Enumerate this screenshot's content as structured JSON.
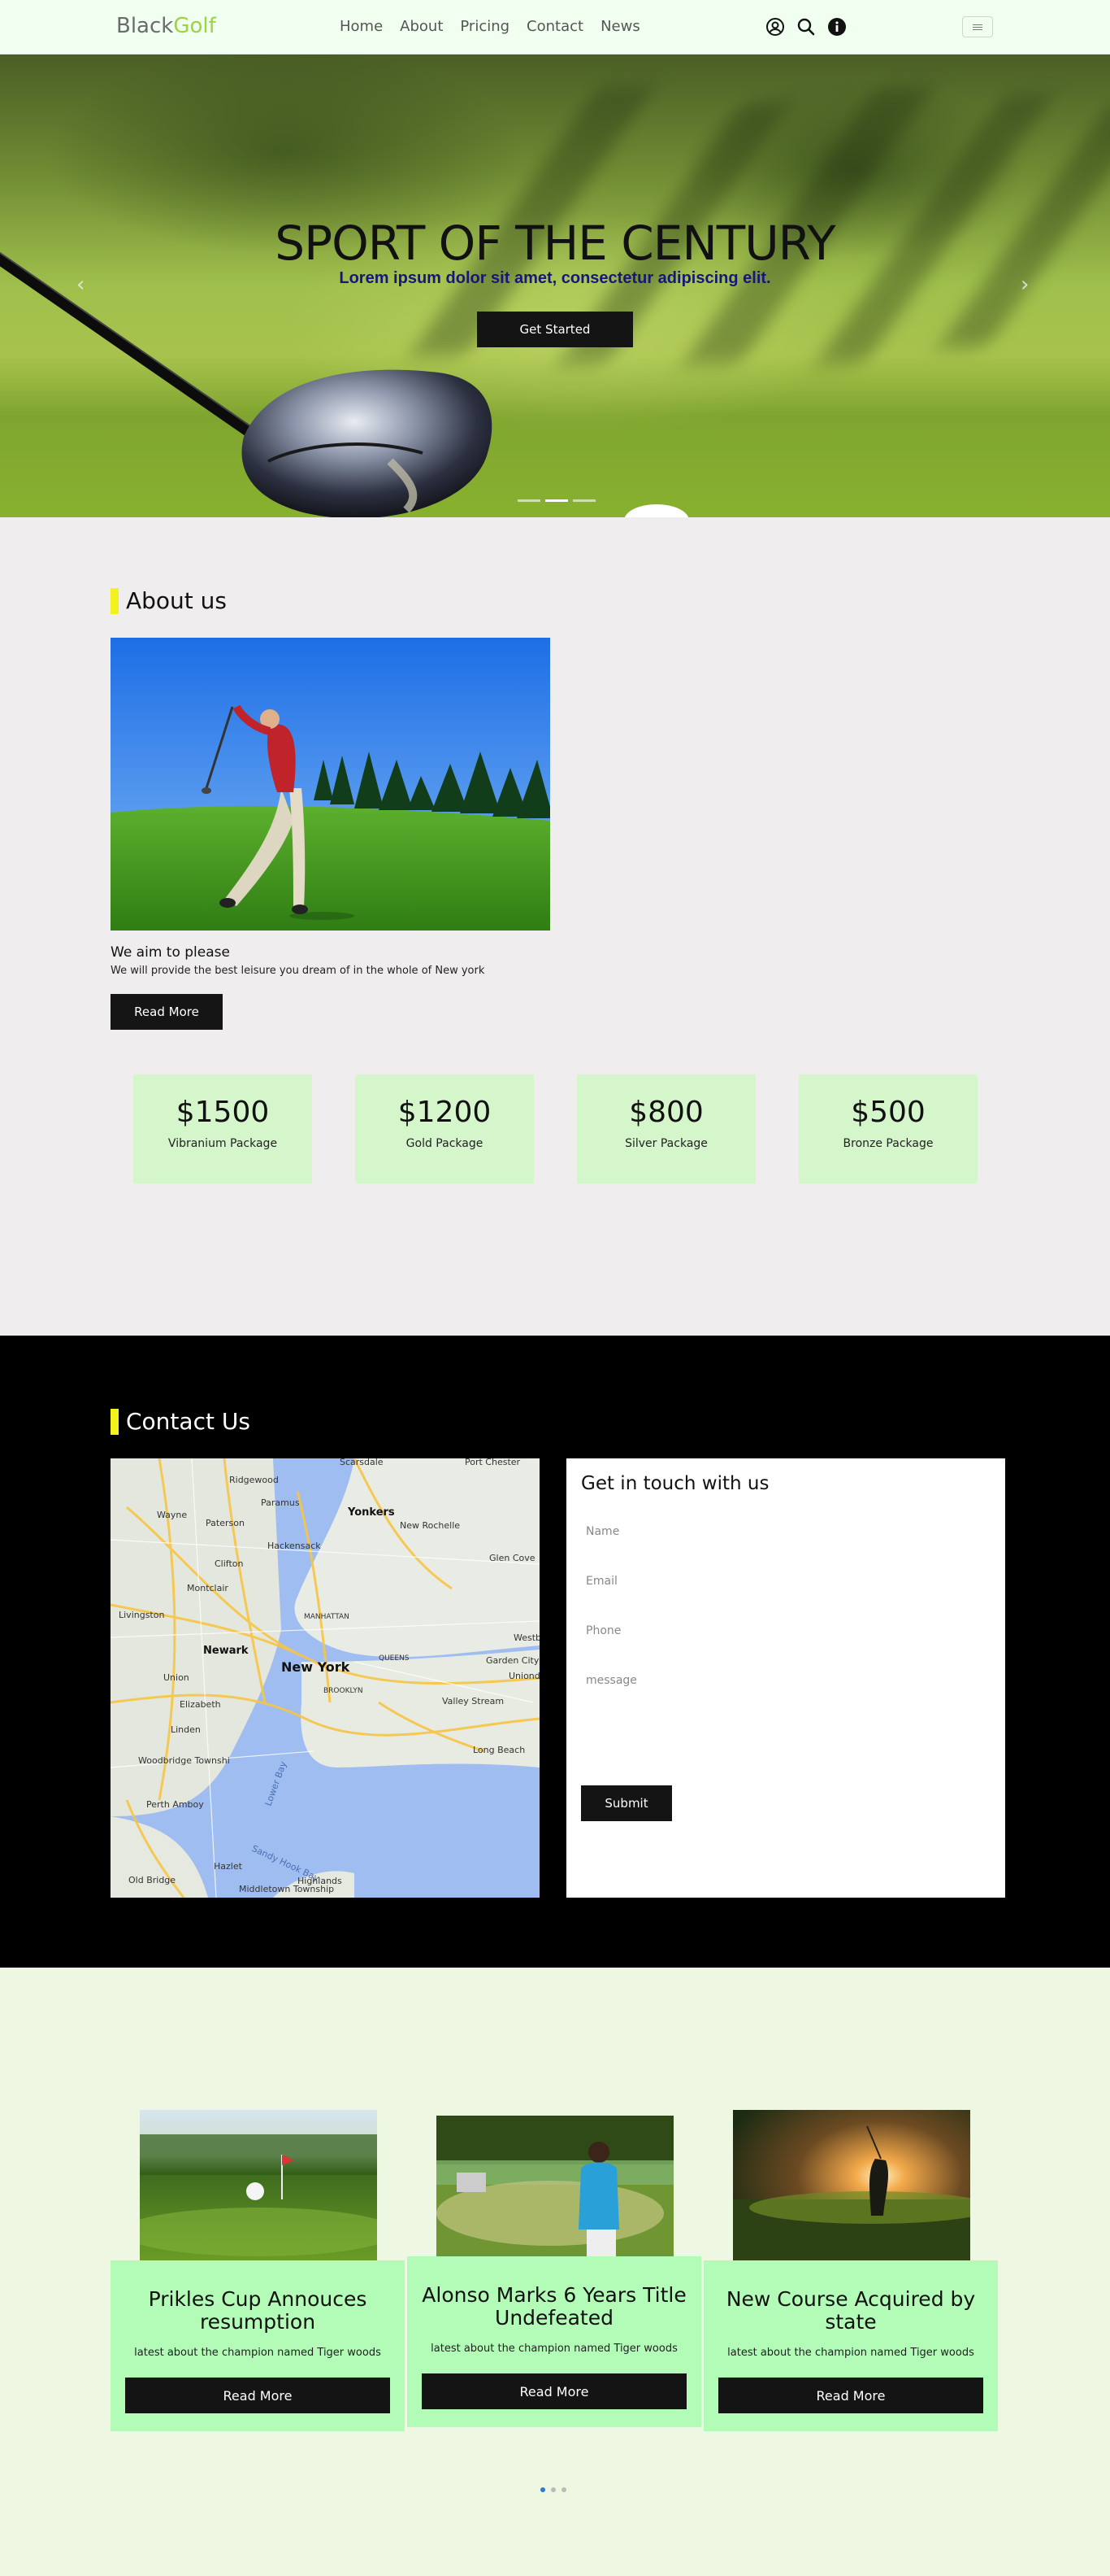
{
  "navbar": {
    "brand_part1": "Black",
    "brand_part2": "Golf",
    "links": [
      "Home",
      "About",
      "Pricing",
      "Contact",
      "News"
    ],
    "icons": [
      "user-circle-icon",
      "search-icon",
      "info-icon"
    ],
    "toggler_icon": "hamburger-menu-icon"
  },
  "hero": {
    "title": "SPORT OF THE CENTURY",
    "subtitle": "Lorem ipsum dolor sit amet, consectetur adipiscing elit.",
    "cta": "Get Started",
    "prev_arrow": "‹",
    "next_arrow": "›",
    "slides": 3,
    "active_slide": 1
  },
  "about": {
    "title": "About us",
    "heading": "We aim to please",
    "text": "We will provide the best leisure you dream of in the whole of New york",
    "button": "Read More",
    "packages": [
      {
        "price": "$1500",
        "name": "Vibranium Package"
      },
      {
        "price": "$1200",
        "name": "Gold Package"
      },
      {
        "price": "$800",
        "name": "Silver Package"
      },
      {
        "price": "$500",
        "name": "Bronze Package"
      }
    ]
  },
  "contact": {
    "title": "Contact Us",
    "map_labels": {
      "yonkers": "Yonkers",
      "new_york": "New York",
      "newark": "Newark",
      "paterson": "Paterson",
      "hackensack": "Hackensack",
      "manhattan": "MANHATTAN",
      "brooklyn": "BROOKLYN",
      "queens": "QUEENS",
      "elizabeth": "Elizabeth",
      "garden_city": "Garden City",
      "valley_stream": "Valley Stream",
      "long_beach": "Long Beach",
      "new_rochelle": "New Rochelle",
      "scarsdale": "Scarsdale",
      "port_chester": "Port Chester",
      "ridgewood": "Ridgewood",
      "paramus": "Paramus",
      "clifton": "Clifton",
      "montclair": "Montclair",
      "wayne": "Wayne",
      "glen_cove": "Glen Cove",
      "westbury": "Westbu",
      "uniondale": "Uniond",
      "linden": "Linden",
      "union": "Union",
      "perth_amboy": "Perth Amboy",
      "woodbridge": "Woodbridge Townshi",
      "livingston": "Livingston",
      "hazlet": "Hazlet",
      "middletown": "Middletown Township",
      "old_bridge": "Old Bridge",
      "highlands": "Highlands",
      "lower_bay": "Lower Bay",
      "sandy_hook": "Sandy Hook Bay"
    },
    "form": {
      "heading": "Get in touch with us",
      "name_placeholder": "Name",
      "email_placeholder": "Email",
      "phone_placeholder": "Phone",
      "message_placeholder": "message",
      "submit": "Submit"
    }
  },
  "news": {
    "cards": [
      {
        "title": "Prikles Cup Annouces resumption",
        "text": "latest about the champion named Tiger woods",
        "button": "Read More"
      },
      {
        "title": "Alonso Marks 6 Years Title Undefeated",
        "text": "latest about the champion named Tiger woods",
        "button": "Read More"
      },
      {
        "title": "New Course Acquired by state",
        "text": "latest about the champion named Tiger woods",
        "button": "Read More"
      }
    ],
    "dots": 3,
    "active_dot": 0,
    "accent_color": "#2a7bd8"
  },
  "colors": {
    "brand_accent": "#9bd43f",
    "section_marker": "#f3f21c",
    "package_bg": "#d5f5cb",
    "card_bg": "#b3fcb7",
    "button_bg": "#141414"
  }
}
